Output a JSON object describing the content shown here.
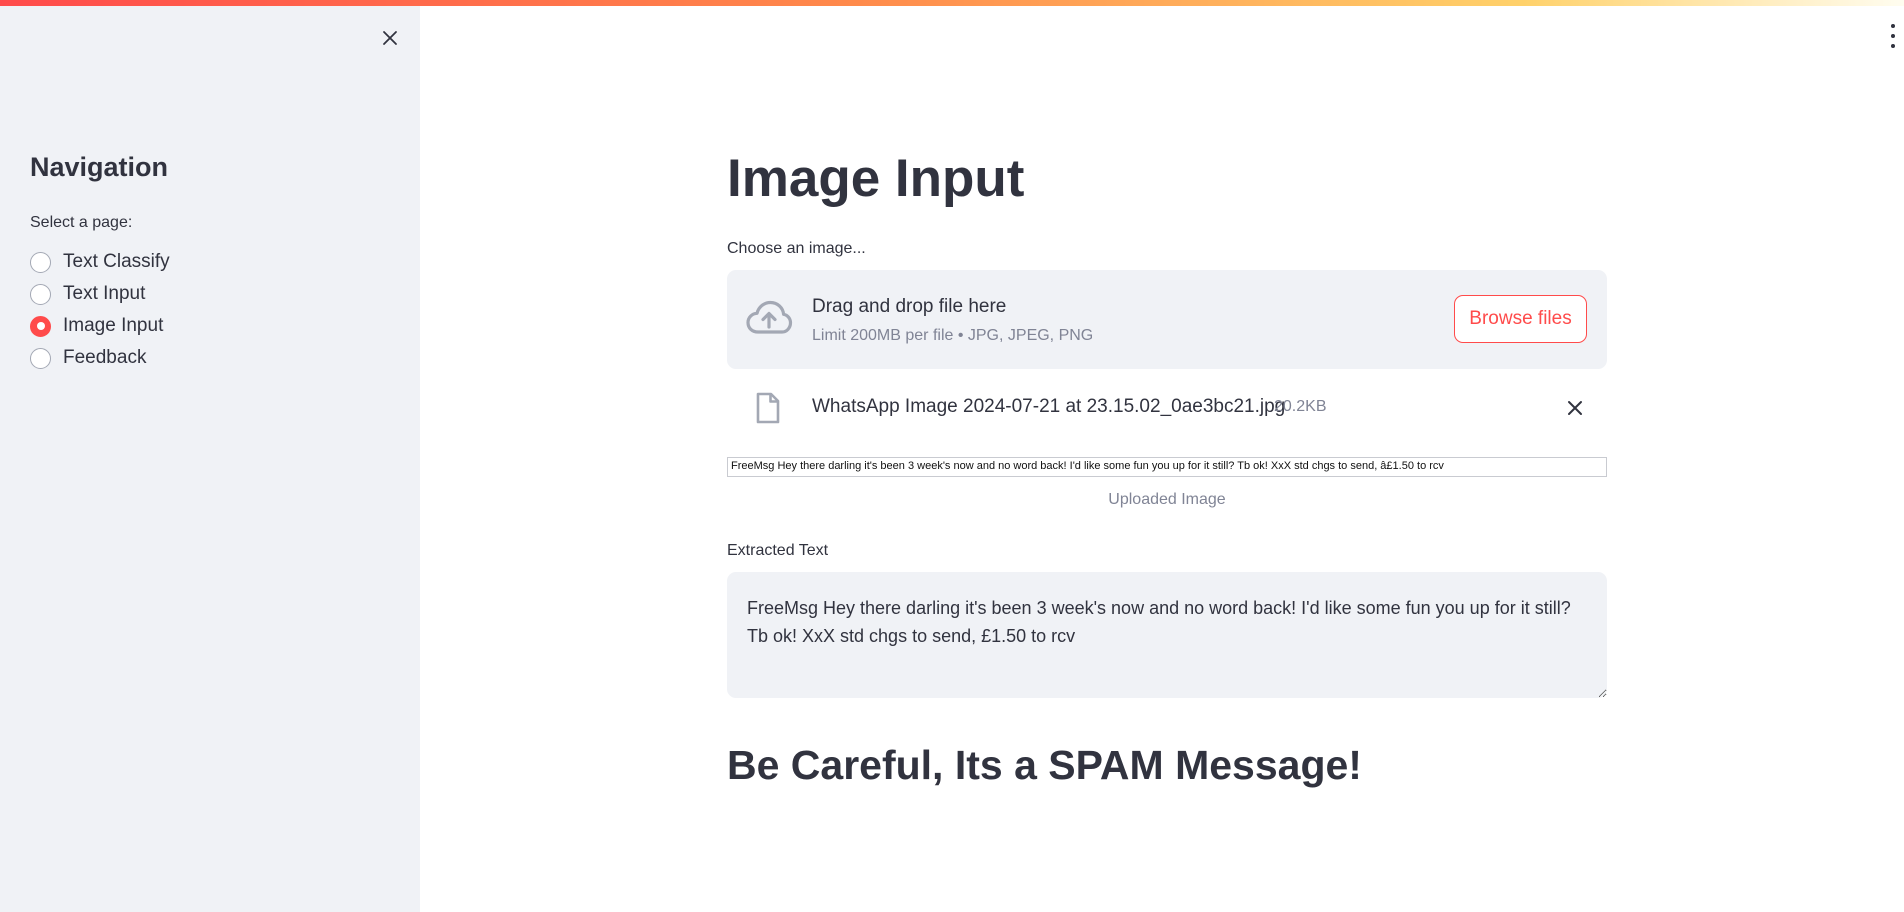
{
  "sidebar": {
    "title": "Navigation",
    "select_label": "Select a page:",
    "pages": [
      {
        "label": "Text Classify",
        "selected": false
      },
      {
        "label": "Text Input",
        "selected": false
      },
      {
        "label": "Image Input",
        "selected": true
      },
      {
        "label": "Feedback",
        "selected": false
      }
    ]
  },
  "main": {
    "title": "Image Input",
    "uploader": {
      "label": "Choose an image...",
      "drop_title": "Drag and drop file here",
      "drop_subtitle": "Limit 200MB per file • JPG, JPEG, PNG",
      "browse_label": "Browse files"
    },
    "uploaded_file": {
      "name": "WhatsApp Image 2024-07-21 at 23.15.02_0ae3bc21.jpg",
      "size": "20.2KB"
    },
    "image_text": "FreeMsg Hey there darling it's been 3 week's now and no word back! I'd like some fun you up for it still? Tb ok! XxX std chgs to send, â£1.50 to rcv",
    "image_caption": "Uploaded Image",
    "extracted_label": "Extracted Text",
    "extracted_text": "FreeMsg Hey there darling it's been 3 week's now and no word back! I'd like some fun you up for it still? Tb ok! XxX std chgs to send, £1.50 to rcv",
    "result": "Be Careful, Its a SPAM Message!"
  },
  "colors": {
    "accent": "#ff4b4b",
    "sidebar_bg": "#f0f2f6",
    "text": "#31333f",
    "muted": "#808495"
  },
  "icons": {
    "close": "close-icon",
    "menu": "more-vertical-icon",
    "upload": "cloud-upload-icon",
    "file": "file-icon",
    "remove": "close-icon"
  }
}
